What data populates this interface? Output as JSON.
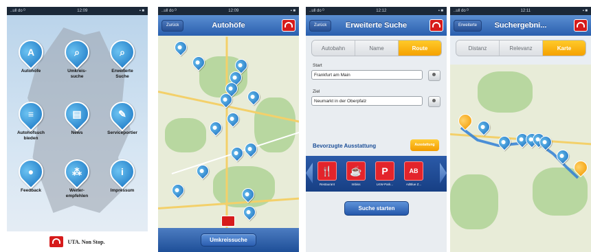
{
  "phones": [
    {
      "status": {
        "carrier": "..ull do  ᴰ",
        "time": "12:09",
        "battery": "▪ ■"
      },
      "menu": [
        {
          "label": "Autohöfe",
          "icon": "truck-icon",
          "glyph": "A"
        },
        {
          "label": "Umkreis-\nsuche",
          "icon": "search-icon",
          "glyph": "⌕"
        },
        {
          "label": "Erweiterte\nSuche",
          "icon": "zoom-icon",
          "glyph": "⌕"
        },
        {
          "label": "Autohofsuch\nbieden",
          "icon": "list-icon",
          "glyph": "≡"
        },
        {
          "label": "News",
          "icon": "news-icon",
          "glyph": "▤"
        },
        {
          "label": "Serviceportier",
          "icon": "wrench-icon",
          "glyph": "✎"
        },
        {
          "label": "Feedback",
          "icon": "chat-icon",
          "glyph": "●"
        },
        {
          "label": "Weiter-\nempfehlen",
          "icon": "share-icon",
          "glyph": "⁂"
        },
        {
          "label": "Impressum",
          "icon": "info-icon",
          "glyph": "i"
        }
      ],
      "footer": {
        "brand": "UTA. Non Stop."
      }
    },
    {
      "status": {
        "carrier": "..ull do  ᴰ",
        "time": "12:09",
        "battery": "▪ ■"
      },
      "nav": {
        "back": "Zurück",
        "title": "Autohöfe"
      },
      "toolbar": {
        "button": "Umkreissuche"
      }
    },
    {
      "status": {
        "carrier": "..ull do  ᴰ",
        "time": "12:12",
        "battery": "▪ ■"
      },
      "nav": {
        "back": "Zurück",
        "title": "Erweiterte Suche"
      },
      "segments": [
        "Autobahn",
        "Name",
        "Route"
      ],
      "start": {
        "label": "Start",
        "value": "Frankfurt am Main"
      },
      "ziel": {
        "label": "Ziel",
        "value": "Neumarkt in der Oberpfalz"
      },
      "preferred": {
        "label": "Bevorzugte Ausstattung",
        "button": "Ausstattung"
      },
      "features": [
        {
          "label": "Restaurant",
          "glyph": "🍴"
        },
        {
          "label": "Imbiss",
          "glyph": "☕"
        },
        {
          "label": "LKW-Park...",
          "glyph": "P"
        },
        {
          "label": "AdBlue Z...",
          "glyph": "AB"
        }
      ],
      "search_button": "Suche starten"
    },
    {
      "status": {
        "carrier": "..ull do  ᴰ",
        "time": "12:11",
        "battery": "▪ ■"
      },
      "nav": {
        "back": "Erweiterte",
        "title": "Suchergebni..."
      },
      "segments": [
        "Distanz",
        "Relevanz",
        "Karte"
      ]
    }
  ],
  "colors": {
    "accent_blue": "#2a5fae",
    "accent_orange": "#f5a100",
    "uta_red": "#d61b1b"
  }
}
